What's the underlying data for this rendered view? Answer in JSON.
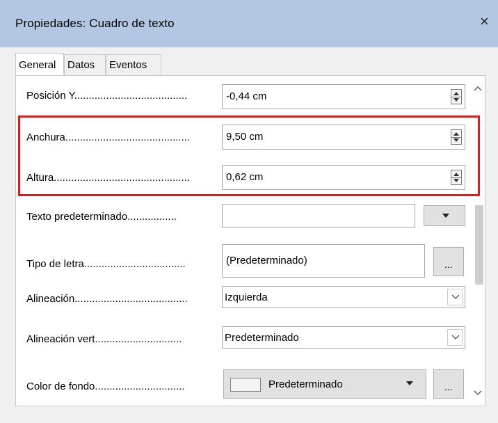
{
  "window": {
    "title": "Propiedades: Cuadro de texto",
    "close_symbol": "×"
  },
  "tabs": [
    {
      "label": "General",
      "active": true
    },
    {
      "label": "Datos",
      "active": false
    },
    {
      "label": "Eventos",
      "active": false
    }
  ],
  "rows": {
    "posicion_y": {
      "label": "Posición Y.......................................",
      "value": "-0,44 cm"
    },
    "anchura": {
      "label": "Anchura...........................................",
      "value": "9,50 cm"
    },
    "altura": {
      "label": "Altura...............................................",
      "value": "0,62 cm"
    },
    "texto_predeterminado": {
      "label": "Texto predeterminado.................",
      "value": ""
    },
    "tipo_de_letra": {
      "label": "Tipo de letra...................................",
      "value": "(Predeterminado)",
      "button": "..."
    },
    "alineacion": {
      "label": "Alineación.......................................",
      "value": "Izquierda"
    },
    "alineacion_vert": {
      "label": "Alineación vert..............................",
      "value": "Predeterminado"
    },
    "color_de_fondo": {
      "label": "Color de fondo...............................",
      "value": "Predeterminado",
      "button": "..."
    }
  },
  "colors": {
    "titlebar": "#b2c7e1",
    "highlight": "#e01b1b",
    "tab_underline": "#e01b1b"
  }
}
